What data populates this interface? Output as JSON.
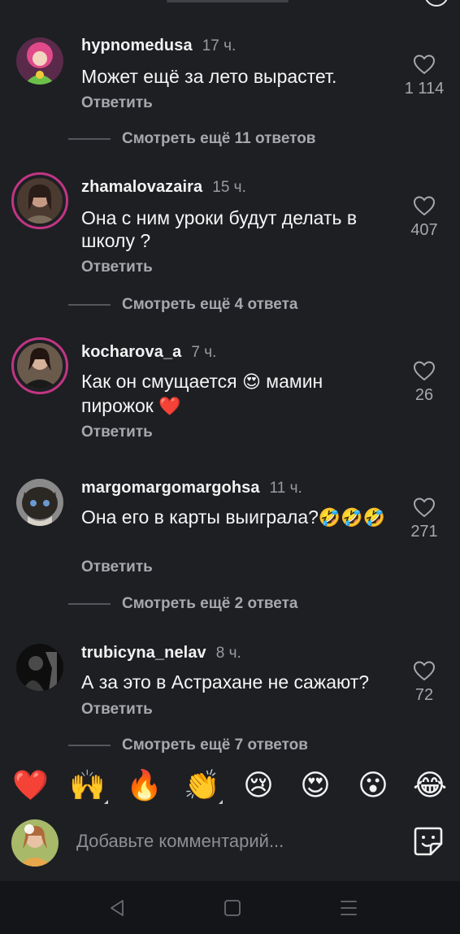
{
  "comments": [
    {
      "username": "hypnomedusa",
      "time": "17 ч.",
      "text": "Может ещё за лето вырастет.",
      "reply": "Ответить",
      "likes": "1 114",
      "more": "Смотреть ещё 11 ответов"
    },
    {
      "username": "zhamalovazaira",
      "time": "15 ч.",
      "text": "Она с ним уроки будут делать в школу ?",
      "reply": "Ответить",
      "likes": "407",
      "more": "Смотреть ещё 4 ответа"
    },
    {
      "username": "kocharova_a",
      "time": "7 ч.",
      "text_before": "Как он смущается",
      "emoji1": "😍",
      "text_after": "мамин пирожок",
      "emoji2": "❤️",
      "reply": "Ответить",
      "likes": "26"
    },
    {
      "username": "margomargomargohsa",
      "time": "11 ч.",
      "text": "Она его в карты выиграла?",
      "emojis": "🤣🤣🤣",
      "reply": "Ответить",
      "likes": "271",
      "more": "Смотреть ещё 2 ответа"
    },
    {
      "username": "trubicyna_nelav",
      "time": "8 ч.",
      "text": "А за это в Астрахане не сажают?",
      "reply": "Ответить",
      "likes": "72",
      "more": "Смотреть ещё 7 ответов"
    }
  ],
  "emoji_bar": [
    "❤️",
    "🙌",
    "🔥",
    "👏",
    "😢",
    "😍",
    "😮",
    "😂"
  ],
  "input": {
    "placeholder": "Добавьте комментарий..."
  },
  "colors": {
    "background": "#1e1f23",
    "text": "#f2f2f2",
    "muted": "#a7a8ad",
    "story_ring": "#c13584",
    "nav": "#141519"
  },
  "icons": {
    "like": "heart-outline-icon",
    "sticker": "sticker-icon",
    "back": "back-triangle-icon",
    "home": "square-home-icon",
    "menu": "menu-lines-icon"
  }
}
